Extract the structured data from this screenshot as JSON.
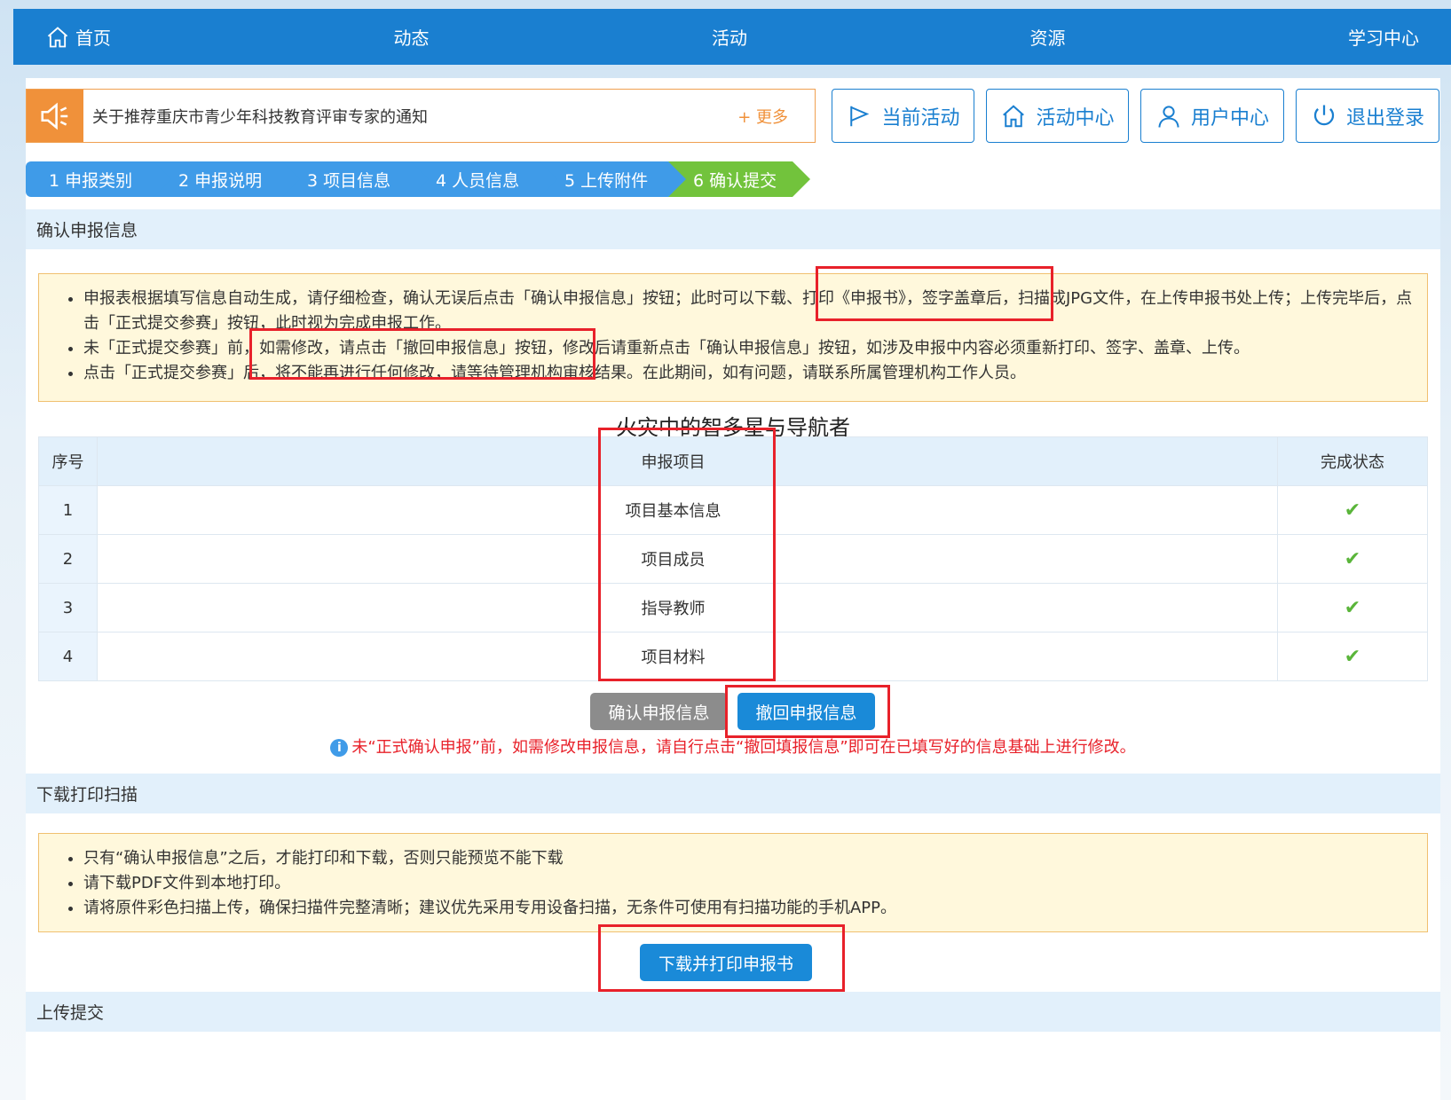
{
  "nav": {
    "home": "首页",
    "news": "动态",
    "activity": "活动",
    "resources": "资源",
    "learning": "学习中心"
  },
  "notice": {
    "text": "关于推荐重庆市青少年科技教育评审专家的通知",
    "more": "+ 更多"
  },
  "top_buttons": {
    "current_activity": "当前活动",
    "activity_center": "活动中心",
    "user_center": "用户中心",
    "logout": "退出登录"
  },
  "steps": [
    "1 申报类别",
    "2 申报说明",
    "3 项目信息",
    "4 人员信息",
    "5 上传附件",
    "6 确认提交"
  ],
  "confirm_section": {
    "title": "确认申报信息",
    "tips": [
      "申报表根据填写信息自动生成，请仔细检查，确认无误后点击「确认申报信息」按钮；此时可以下载、打印《申报书》，签字盖章后，扫描成JPG文件，在上传申报书处上传；上传完毕后，点击「正式提交参赛」按钮，此时视为完成申报工作。",
      "未「正式提交参赛」前，如需修改，请点击「撤回申报信息」按钮，修改后请重新点击「确认申报信息」按钮，如涉及申报中内容必须重新打印、签字、盖章、上传。",
      "点击「正式提交参赛」后，将不能再进行任何修改，请等待管理机构审核结果。在此期间，如有问题，请联系所属管理机构工作人员。"
    ],
    "project_title": "火灾中的智多星与导航者",
    "table": {
      "headers": [
        "序号",
        "申报项目",
        "完成状态"
      ],
      "rows": [
        {
          "idx": "1",
          "name": "项目基本信息",
          "status": "✔"
        },
        {
          "idx": "2",
          "name": "项目成员",
          "status": "✔"
        },
        {
          "idx": "3",
          "name": "指导教师",
          "status": "✔"
        },
        {
          "idx": "4",
          "name": "项目材料",
          "status": "✔"
        }
      ]
    },
    "confirm_button": "确认申报信息",
    "withdraw_button": "撤回申报信息",
    "hint": "未“正式确认申报”前，如需修改申报信息，请自行点击“撤回填报信息”即可在已填写好的信息基础上进行修改。"
  },
  "download_section": {
    "title": "下载打印扫描",
    "tips": [
      "只有“确认申报信息”之后，才能打印和下载，否则只能预览不能下载",
      "请下载PDF文件到本地打印。",
      "请将原件彩色扫描上传，确保扫描件完整清晰；建议优先采用专用设备扫描，无条件可使用有扫描功能的手机APP。"
    ],
    "download_button": "下载并打印申报书"
  },
  "upload_section": {
    "title": "上传提交"
  },
  "colors": {
    "primary": "#1a7fd0",
    "step": "#3f9be8",
    "step_active": "#72c33c",
    "highlight_box": "#e8212a",
    "notice_accent": "#f0913a"
  }
}
